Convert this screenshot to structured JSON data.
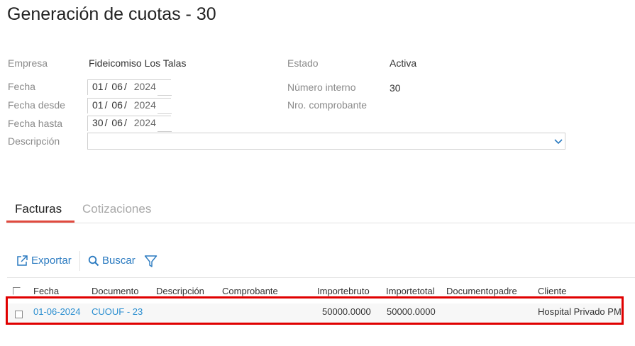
{
  "page": {
    "title": "Generación de cuotas - 30"
  },
  "form": {
    "empresa_label": "Empresa",
    "empresa_value": "Fideicomiso Los Talas",
    "estado_label": "Estado",
    "estado_value": "Activa",
    "fecha_label": "Fecha",
    "fecha": {
      "day": "01",
      "month": "06",
      "year": "2024"
    },
    "numero_interno_label": "Número interno",
    "numero_interno_value": "30",
    "fecha_desde_label": "Fecha desde",
    "fecha_desde": {
      "day": "01",
      "month": "06",
      "year": "2024"
    },
    "nro_comprobante_label": "Nro. comprobante",
    "fecha_hasta_label": "Fecha hasta",
    "fecha_hasta": {
      "day": "30",
      "month": "06",
      "year": "2024"
    },
    "descripcion_label": "Descripción",
    "descripcion_value": ""
  },
  "tabs": [
    {
      "label": "Facturas",
      "active": true
    },
    {
      "label": "Cotizaciones",
      "active": false
    }
  ],
  "toolbar": {
    "export_label": "Exportar",
    "search_label": "Buscar",
    "export_icon": "external-link-icon",
    "search_icon": "search-icon",
    "filter_icon": "filter-icon"
  },
  "table": {
    "columns": [
      "Fecha",
      "Documento",
      "Descripción",
      "Comprobante",
      "Importebruto",
      "Importetotal",
      "Documentopadre",
      "Cliente"
    ],
    "rows": [
      {
        "fecha": "01-06-2024",
        "documento": "CUOUF - 23",
        "descripcion": "",
        "comprobante": "",
        "importebruto": "50000.0000",
        "importetotal": "50000.0000",
        "documentopadre": "",
        "cliente": "Hospital Privado PM"
      }
    ]
  },
  "colors": {
    "accent": "#2a7ac0",
    "tab_active": "#e04a3f",
    "highlight": "#e00000"
  }
}
